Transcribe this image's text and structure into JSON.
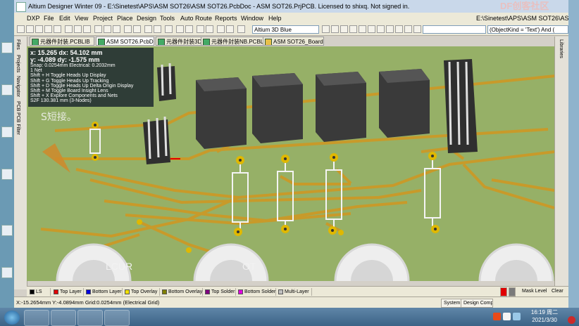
{
  "window": {
    "title": "Altium Designer Winter 09 - E:\\Sinetest\\APS\\ASM SOT26\\ASM SOT26.PcbDoc - ASM SOT26.PrjPCB. Licensed to shixq. Not signed in.",
    "watermark": "DF创客社区"
  },
  "menu": {
    "items": [
      "DXP",
      "File",
      "Edit",
      "View",
      "Project",
      "Place",
      "Design",
      "Tools",
      "Auto Route",
      "Reports",
      "Window",
      "Help"
    ],
    "path": "E:\\Sinetest\\APS\\ASM SOT26\\ASM"
  },
  "toolbar": {
    "view_mode": "Altium 3D Blue",
    "query": "(ObjectKind = 'Text') And (",
    "empty_select": ""
  },
  "tabs": [
    "元器件封装.PCBLIB",
    "ASM SOT26.PcbDoc",
    "元器件封装3D.PcbLib",
    "元器件封装NB.PCBLIB",
    "ASM SOT26_Board.Sch"
  ],
  "left_panels": [
    "Files",
    "Projects",
    "Navigator",
    "PCB",
    "PCB Filter"
  ],
  "right_panels": [
    "Libraries"
  ],
  "hud": {
    "x_line": "x: 15.265   dx: 54.102 mm",
    "y_line": "y: -4.089   dy: -1.575  mm",
    "snap": "Snap: 0.0254mm Electrical: 0.2032mm",
    "net": "1 Net",
    "shortcuts": [
      "Shift + H   Toggle Heads Up Display",
      "Shift + G   Toggle Heads Up Tracking",
      "Shift + D   Toggle Heads Up Delta Origin Display",
      "Shift + M   Toggle Board Insight Lens",
      "Shift + X   Explore Components and Nets"
    ],
    "s2f": "S2F  130.381 mm  (3-Nodes)",
    "overlay_text": "S短接。"
  },
  "board": {
    "silkscreen": [
      "LCUR",
      "OT"
    ]
  },
  "layers": [
    {
      "name": "LS",
      "color": "#000000"
    },
    {
      "name": "Top Layer",
      "color": "#e00000"
    },
    {
      "name": "Bottom Layer",
      "color": "#0000e0"
    },
    {
      "name": "Top Overlay",
      "color": "#f0e000"
    },
    {
      "name": "Bottom Overlay",
      "color": "#808000"
    },
    {
      "name": "Top Solder",
      "color": "#800080"
    },
    {
      "name": "Bottom Solder",
      "color": "#e000e0"
    },
    {
      "name": "Multi-Layer",
      "color": "#c0c0c0"
    }
  ],
  "layer_tools": [
    "Mask Level",
    "Clear"
  ],
  "status": {
    "coords": "X:-15.2654mm Y:-4.0894mm   Grid:0.0254mm   (Electrical Grid)",
    "buttons": [
      "System",
      "Design Compiler"
    ]
  },
  "taskbar": {
    "time": "16:19 周二",
    "date": "2021/3/30"
  }
}
